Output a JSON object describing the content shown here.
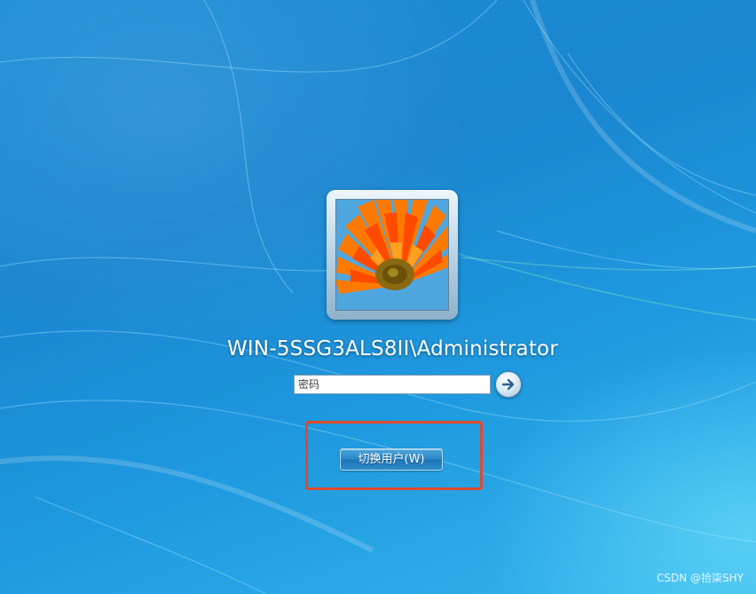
{
  "login": {
    "username": "WIN-5SSG3ALS8II\\Administrator",
    "password_placeholder": "密码",
    "submit_icon": "arrow-right-icon",
    "switch_user_label": "切换用户(W)"
  },
  "avatar": {
    "icon": "flower-user-picture"
  },
  "watermark": {
    "text": "CSDN @拾柒SHY"
  },
  "colors": {
    "background": "#1a86d0",
    "highlight_border": "#e04a2c",
    "button": "#2b86c6"
  }
}
